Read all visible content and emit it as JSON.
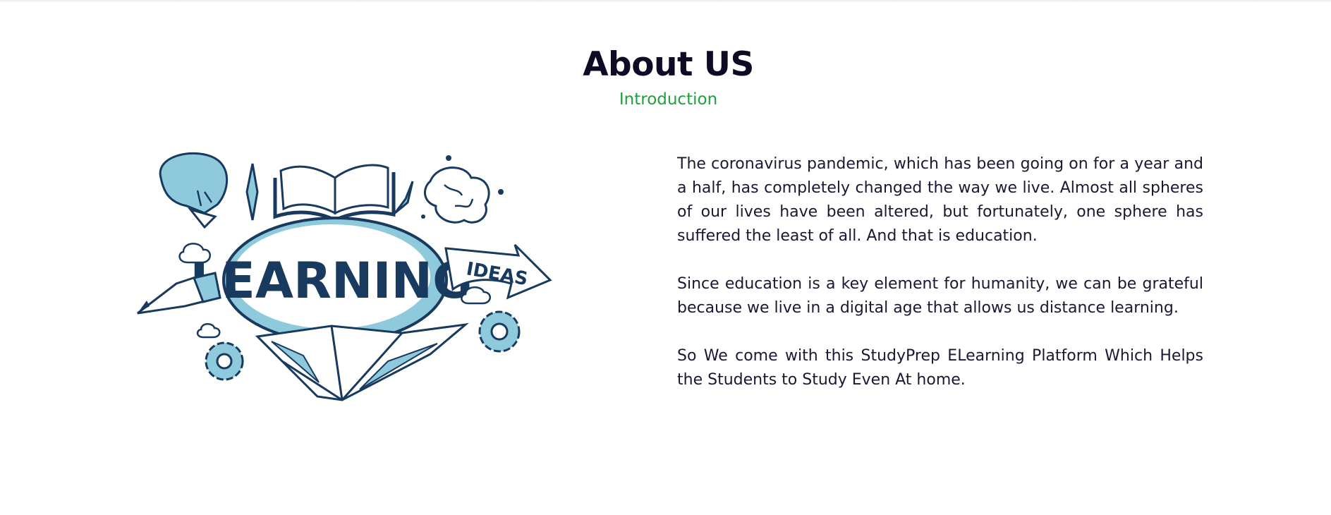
{
  "section": {
    "title": "About US",
    "subtitle": "Introduction"
  },
  "illustration": {
    "main_word": "LEARNING",
    "arrow_word": "IDEAS"
  },
  "paragraphs": [
    "The coronavirus pandemic, which has been going on for a year and a half, has completely changed the way we live. Almost all spheres of our lives have been altered, but fortunately, one sphere has suffered the least of all. And that is education.",
    "Since education is a key element for humanity, we can be grateful because we live in a digital age that allows us distance learning.",
    "So We come with this StudyPrep ELearning Platform Which Helps the Students to Study Even At home."
  ],
  "colors": {
    "title": "#0e0c24",
    "subtitle": "#1f9f3e",
    "ink": "#173a5e",
    "light_blue": "#8ec9dc"
  }
}
